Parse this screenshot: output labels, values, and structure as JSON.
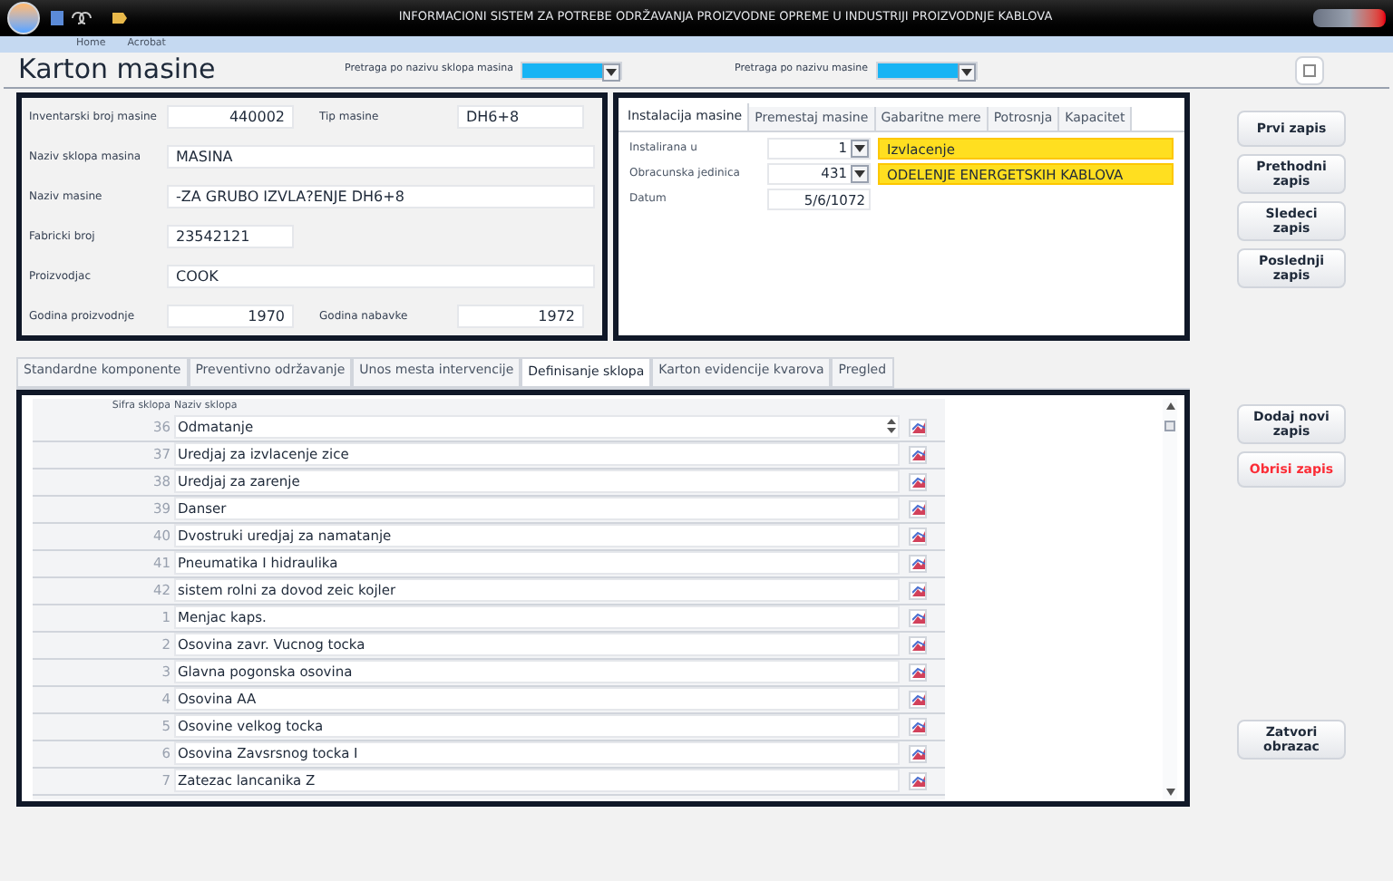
{
  "window": {
    "title": "INFORMACIONI SISTEM ZA POTREBE ODRŽAVANJA PROIZVODNE OPREME U INDUSTRIJI PROIZVODNJE KABLOVA"
  },
  "ribbon_tabs": [
    {
      "label": "Home"
    },
    {
      "label": "Acrobat"
    }
  ],
  "header": {
    "title": "Karton masine",
    "search_1_label": "Pretraga po nazivu sklopa masina",
    "search_2_label": "Pretraga po nazivu masine"
  },
  "machine_fields": [
    [
      {
        "label": "Inventarski broj masine",
        "value": "440002",
        "kind": "number"
      },
      {
        "label": "Tip masine",
        "value": "DH6+8",
        "kind": "text"
      }
    ],
    [
      {
        "label": "Naziv sklopa masina",
        "value": "MASINA",
        "kind": "text"
      }
    ],
    [
      {
        "label": "Naziv masine",
        "value": "-ZA GRUBO IZVLA?ENJE DH6+8",
        "kind": "text"
      }
    ],
    [
      {
        "label": "Fabricki broj",
        "value": "23542121",
        "kind": "code"
      }
    ],
    [
      {
        "label": "Proizvodjac",
        "value": "COOK",
        "kind": "text"
      }
    ],
    [
      {
        "label": "Godina proizvodnje",
        "value": "1970",
        "kind": "number"
      },
      {
        "label": "Godina nabavke",
        "value": "1972",
        "kind": "number"
      }
    ]
  ],
  "detail_tabs": [
    {
      "label": "Instalacija masine",
      "selected": true
    },
    {
      "label": "Premestaj masine",
      "selected": false
    },
    {
      "label": "Gabaritne mere",
      "selected": false
    },
    {
      "label": "Potrosnja",
      "selected": false
    },
    {
      "label": "Kapacitet",
      "selected": false
    }
  ],
  "installation_fields": [
    {
      "label": "Instalirana u",
      "value": "1",
      "kind": "combo",
      "description": "Izvlacenje"
    },
    {
      "label": "Obracunska jedinica",
      "value": "431",
      "kind": "combo",
      "description": "ODELENJE ENERGETSKIH KABLOVA"
    },
    {
      "label": "Datum",
      "value": "5/6/1072",
      "kind": "text"
    }
  ],
  "nav_buttons": [
    {
      "label": "Prvi zapis"
    },
    {
      "label": "Prethodni zapis"
    },
    {
      "label": "Sledeci zapis"
    },
    {
      "label": "Poslednji zapis"
    }
  ],
  "lower_tabs": [
    {
      "label": "Standardne komponente",
      "selected": false
    },
    {
      "label": "Preventivno održavanje",
      "selected": false
    },
    {
      "label": "Unos mesta intervencije",
      "selected": false
    },
    {
      "label": "Definisanje sklopa",
      "selected": true
    },
    {
      "label": "Karton evidencije kvarova",
      "selected": false
    },
    {
      "label": "Pregled",
      "selected": false
    }
  ],
  "table": {
    "columns": [
      "Sifra sklopa",
      "Naziv sklopa"
    ],
    "rows": [
      {
        "code": "36",
        "name": "Odmatanje",
        "kind": "combo"
      },
      {
        "code": "37",
        "name": "Uredjaj za izvlacenje zice",
        "kind": "text"
      },
      {
        "code": "38",
        "name": "Uredjaj za zarenje",
        "kind": "text"
      },
      {
        "code": "39",
        "name": "Danser",
        "kind": "text"
      },
      {
        "code": "40",
        "name": "Dvostruki uredjaj za namatanje",
        "kind": "text"
      },
      {
        "code": "41",
        "name": "Pneumatika I hidraulika",
        "kind": "text"
      },
      {
        "code": "42",
        "name": "sistem rolni za dovod zeic kojler",
        "kind": "text"
      },
      {
        "code": "1",
        "name": "Menjac kaps.",
        "kind": "text"
      },
      {
        "code": "2",
        "name": "Osovina zavr. Vucnog tocka",
        "kind": "text"
      },
      {
        "code": "3",
        "name": "Glavna pogonska osovina",
        "kind": "text"
      },
      {
        "code": "4",
        "name": "Osovina AA",
        "kind": "text"
      },
      {
        "code": "5",
        "name": "Osovine velkog tocka",
        "kind": "text"
      },
      {
        "code": "6",
        "name": "Osovina Zavsrsnog tocka I",
        "kind": "text"
      },
      {
        "code": "7",
        "name": "Zatezac lancanika Z",
        "kind": "text"
      }
    ]
  },
  "record_buttons": [
    {
      "label": "Dodaj novi zapis",
      "kind": "normal"
    },
    {
      "label": "Obrisi zapis",
      "kind": "danger"
    }
  ],
  "close_button": {
    "label": "Zatvori obrazac"
  }
}
